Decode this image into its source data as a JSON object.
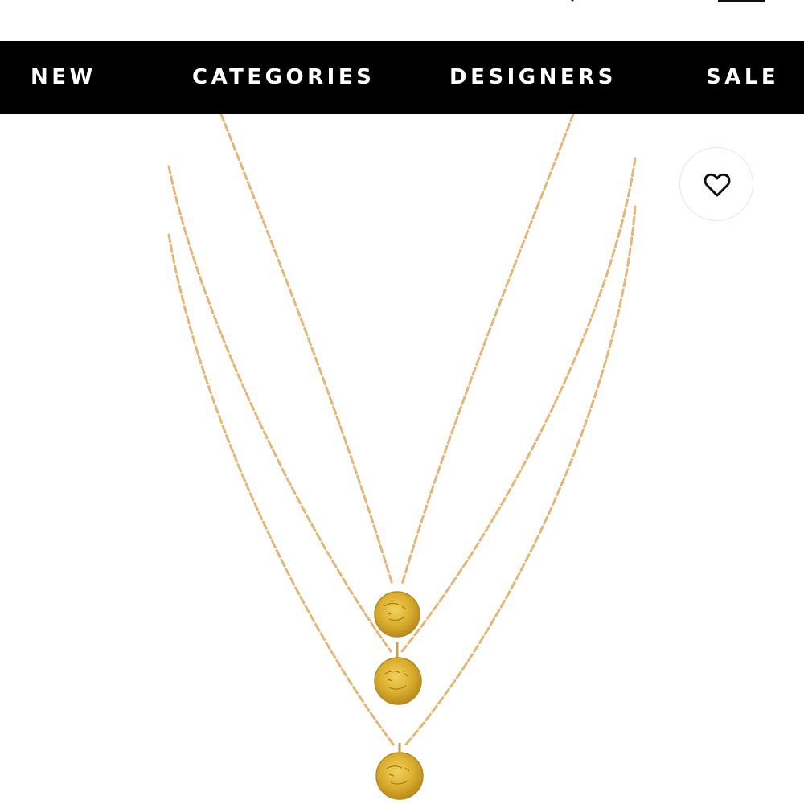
{
  "nav": {
    "items": [
      {
        "label": "NEW"
      },
      {
        "label": "CATEGORIES"
      },
      {
        "label": "DESIGNERS"
      },
      {
        "label": "SALE"
      }
    ]
  },
  "header": {
    "icons": [
      "search-icon",
      "menu-icon"
    ]
  },
  "product": {
    "image": "gold-layered-coin-necklace",
    "wishlist_icon": "heart-icon"
  },
  "colors": {
    "nav_background": "#000000",
    "nav_text": "#ffffff",
    "chain_gold": "#e2b77a",
    "coin_gold": "#d6a92c"
  }
}
